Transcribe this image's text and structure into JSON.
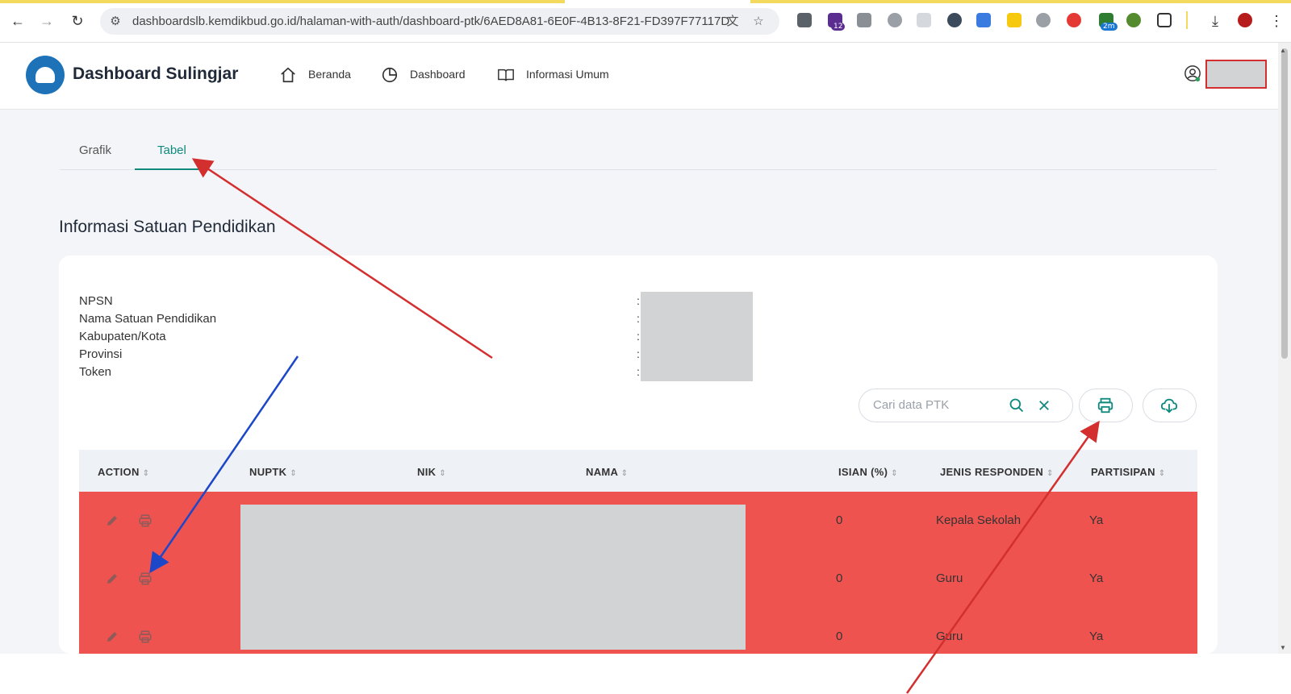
{
  "browser": {
    "url": "dashboardslb.kemdikbud.go.id/halaman-with-auth/dashboard-ptk/6AED8A81-6E0F-4B13-8F21-FD397F77117D",
    "ext_badges": [
      "12",
      "2m"
    ]
  },
  "header": {
    "brand": "Dashboard Sulingjar",
    "nav": [
      {
        "label": "Beranda",
        "icon": "home-icon"
      },
      {
        "label": "Dashboard",
        "icon": "pie-chart-icon"
      },
      {
        "label": "Informasi Umum",
        "icon": "book-icon"
      }
    ]
  },
  "tabs": [
    {
      "label": "Grafik",
      "active": false
    },
    {
      "label": "Tabel",
      "active": true
    }
  ],
  "section_title": "Informasi Satuan Pendidikan",
  "info": {
    "labels": [
      "NPSN",
      "Nama Satuan Pendidikan",
      "Kabupaten/Kota",
      "Provinsi",
      "Token"
    ],
    "colon": ":"
  },
  "search": {
    "placeholder": "Cari data PTK"
  },
  "table": {
    "headers": [
      "ACTION",
      "NUPTK",
      "NIK",
      "NAMA",
      "ISIAN (%)",
      "JENIS RESPONDEN",
      "PARTISIPAN"
    ],
    "rows": [
      {
        "isian": "0",
        "jenis": "Kepala Sekolah",
        "partisipan": "Ya"
      },
      {
        "isian": "0",
        "jenis": "Guru",
        "partisipan": "Ya"
      },
      {
        "isian": "0",
        "jenis": "Guru",
        "partisipan": "Ya"
      }
    ]
  },
  "colors": {
    "accent": "#0f8a7d",
    "row_highlight": "#ef5350",
    "annotation_red": "#d32f2f",
    "annotation_blue": "#1d47c9"
  }
}
